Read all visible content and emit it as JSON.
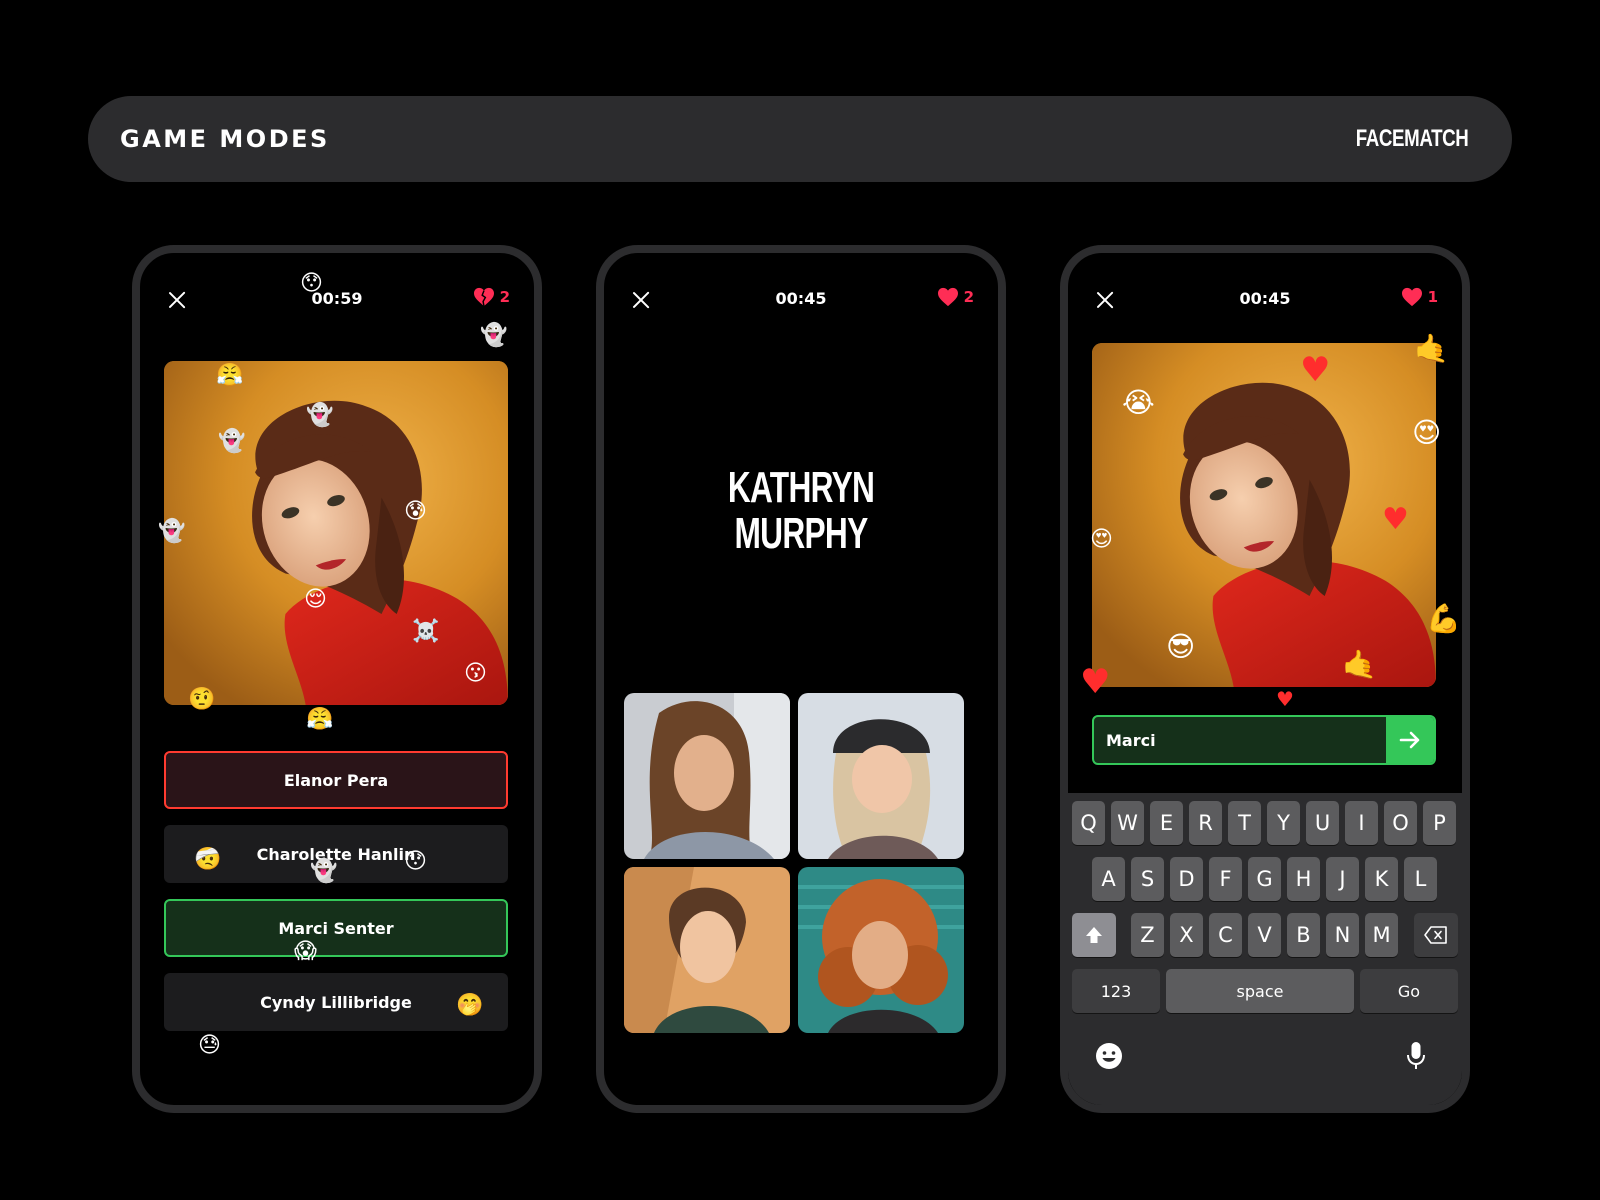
{
  "header": {
    "title": "GAME MODES",
    "brand": "FACEMATCH"
  },
  "colors": {
    "accent_red": "#ff2d55",
    "correct_green": "#34c759",
    "wrong_red": "#ff3b30",
    "panel": "#2c2c2e"
  },
  "phone1": {
    "timer": "00:59",
    "lives_count": "2",
    "lives_icon": "broken-heart-icon",
    "options": [
      "Elanor Pera",
      "Charolette Hanlin",
      "Marci Senter",
      "Cyndy Lillibridge"
    ],
    "emojis": [
      "😯",
      "👻",
      "😤",
      "👻",
      "👻",
      "😰",
      "👻",
      "😌",
      "☠️",
      "😗",
      "🤨",
      "😤",
      "🤕",
      "😯",
      "👻",
      "😱",
      "🤭",
      "😓"
    ]
  },
  "phone2": {
    "timer": "00:45",
    "lives_count": "2",
    "lives_icon": "heart-icon",
    "name_line1": "KATHRYN",
    "name_line2": "MURPHY"
  },
  "phone3": {
    "timer": "00:45",
    "lives_count": "1",
    "lives_icon": "heart-icon",
    "answer_value": "Marci",
    "emojis": [
      "♥",
      "🤙",
      "😭",
      "😍",
      "♥",
      "😍",
      "😎",
      "💪",
      "♥",
      "🤙",
      "♥"
    ],
    "keyboard": {
      "row1": [
        "Q",
        "W",
        "E",
        "R",
        "T",
        "Y",
        "U",
        "I",
        "O",
        "P"
      ],
      "row2": [
        "A",
        "S",
        "D",
        "F",
        "G",
        "H",
        "J",
        "K",
        "L"
      ],
      "row3": [
        "Z",
        "X",
        "C",
        "V",
        "B",
        "N",
        "M"
      ],
      "numbers_label": "123",
      "space_label": "space",
      "go_label": "Go"
    }
  }
}
